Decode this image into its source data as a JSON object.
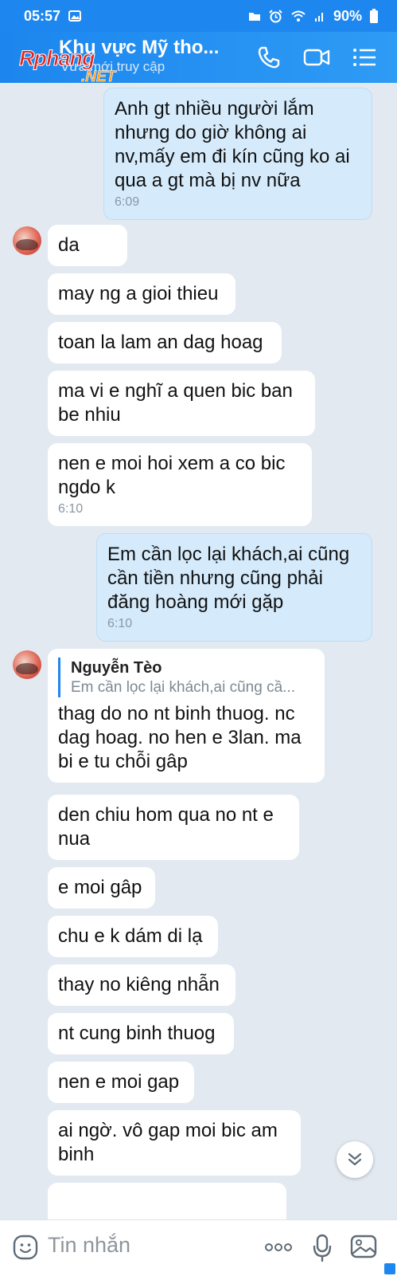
{
  "status_bar": {
    "time": "05:57",
    "battery": "90%",
    "icons": [
      "image-icon",
      "folder-icon",
      "alarm-icon",
      "wifi-icon",
      "signal-icon",
      "battery-icon"
    ]
  },
  "header": {
    "title": "Khu vực Mỹ tho...",
    "subtitle": "Vừa mới truy cập",
    "logo": "Rphang.NET",
    "icons": [
      "phone-icon",
      "video-icon",
      "menu-icon"
    ]
  },
  "messages": [
    {
      "dir": "out",
      "text": "Anh gt nhiều người lắm nhưng do giờ không ai nv,mấy em đi kín cũng ko ai qua a gt mà bị nv nữa",
      "time": "6:09"
    },
    {
      "dir": "in",
      "text": "da",
      "avatar": true
    },
    {
      "dir": "in",
      "text": "may ng a gioi thieu"
    },
    {
      "dir": "in",
      "text": "toan la lam an dag hoag"
    },
    {
      "dir": "in",
      "text": "ma vi e nghĩ a quen bic ban be nhiu"
    },
    {
      "dir": "in",
      "text": "nen e moi hoi xem a co bic ngdo k",
      "time": "6:10"
    },
    {
      "dir": "out",
      "text": "Em cần lọc lại khách,ai cũng cần tiền nhưng cũng phải đăng hoàng mới gặp",
      "time": "6:10"
    },
    {
      "dir": "in",
      "avatar": true,
      "quote": {
        "author": "Nguyễn Tèo",
        "text": "Em cần lọc lại khách,ai cũng cầ..."
      },
      "text": "thag do no nt binh thuog. nc dag hoag. no hen e 3lan. ma bi e tu chỗi gâp"
    },
    {
      "dir": "in",
      "text": "den chiu hom qua no nt e nua"
    },
    {
      "dir": "in",
      "text": "e moi gâp"
    },
    {
      "dir": "in",
      "text": "chu e k dám di lạ"
    },
    {
      "dir": "in",
      "text": "thay no kiêng nhẫn"
    },
    {
      "dir": "in",
      "text": "nt cung binh thuog"
    },
    {
      "dir": "in",
      "text": "nen e moi gap"
    },
    {
      "dir": "in",
      "text": "ai ngờ. vô gap moi bic am binh"
    }
  ],
  "input_bar": {
    "placeholder": "Tin nhắn",
    "icons": [
      "emoji-icon",
      "more-icon",
      "microphone-icon",
      "image-icon"
    ]
  },
  "colors": {
    "header": "#1e87ef",
    "background": "#e2e9f1",
    "incoming": "#ffffff",
    "outgoing": "#d5ebfc"
  }
}
